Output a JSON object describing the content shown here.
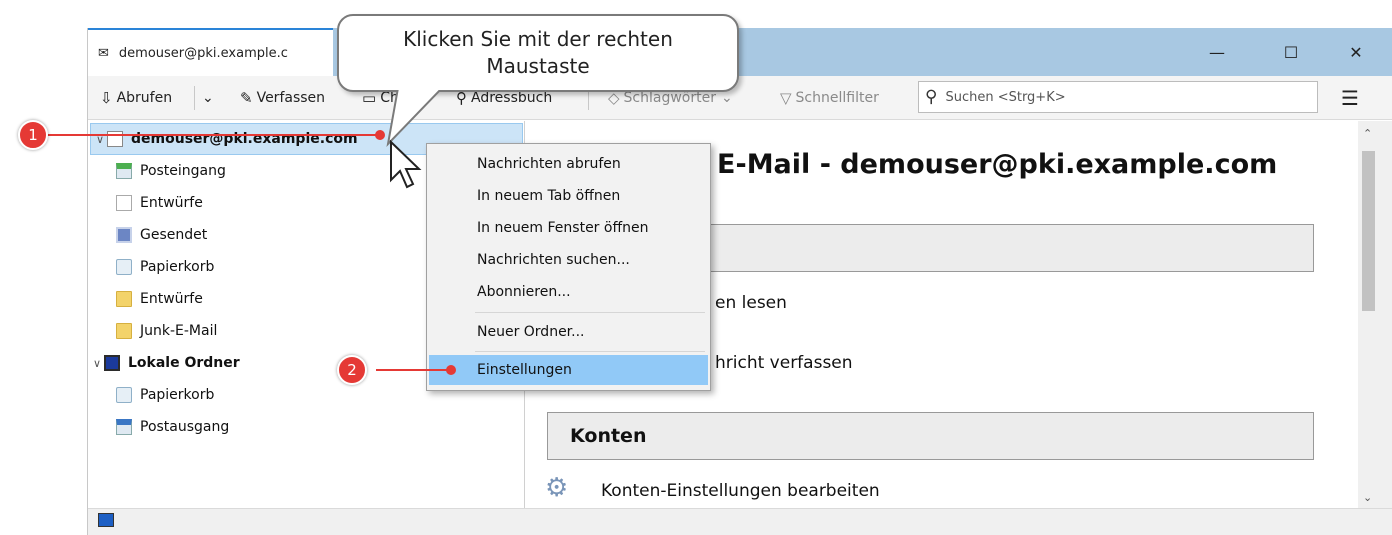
{
  "window": {
    "tab_title": "demouser@pki.example.c",
    "minimize": "—",
    "maximize": "☐",
    "close": "✕"
  },
  "toolbar": {
    "get_mail": "Abrufen",
    "compose": "Verfassen",
    "chat": "Chat",
    "address_book": "Adressbuch",
    "tags": "Schlagwörter",
    "quick_filter": "Schnellfilter",
    "search_placeholder": "Suchen <Strg+K>"
  },
  "folders": {
    "account": "demouser@pki.example.com",
    "items": [
      "Posteingang",
      "Entwürfe",
      "Gesendet",
      "Papierkorb",
      "Entwürfe",
      "Junk-E-Mail"
    ],
    "local_label": "Lokale Ordner",
    "local_items": [
      "Papierkorb",
      "Postausgang"
    ]
  },
  "content": {
    "heading": "rd E-Mail - demouser@pki.example.com",
    "read_messages": "en lesen",
    "write_message": "hricht verfassen",
    "accounts_title": "Konten",
    "account_settings": "Konten-Einstellungen bearbeiten"
  },
  "context_menu": {
    "items": [
      "Nachrichten abrufen",
      "In neuem Tab öffnen",
      "In neuem Fenster öffnen",
      "Nachrichten suchen...",
      "Abonnieren...",
      "Neuer Ordner...",
      "Einstellungen"
    ],
    "highlighted": "Einstellungen"
  },
  "annotations": {
    "callout_line1": "Klicken Sie mit der rechten",
    "callout_line2": "Maustaste",
    "badge1": "1",
    "badge2": "2",
    "color": "#e53935"
  }
}
